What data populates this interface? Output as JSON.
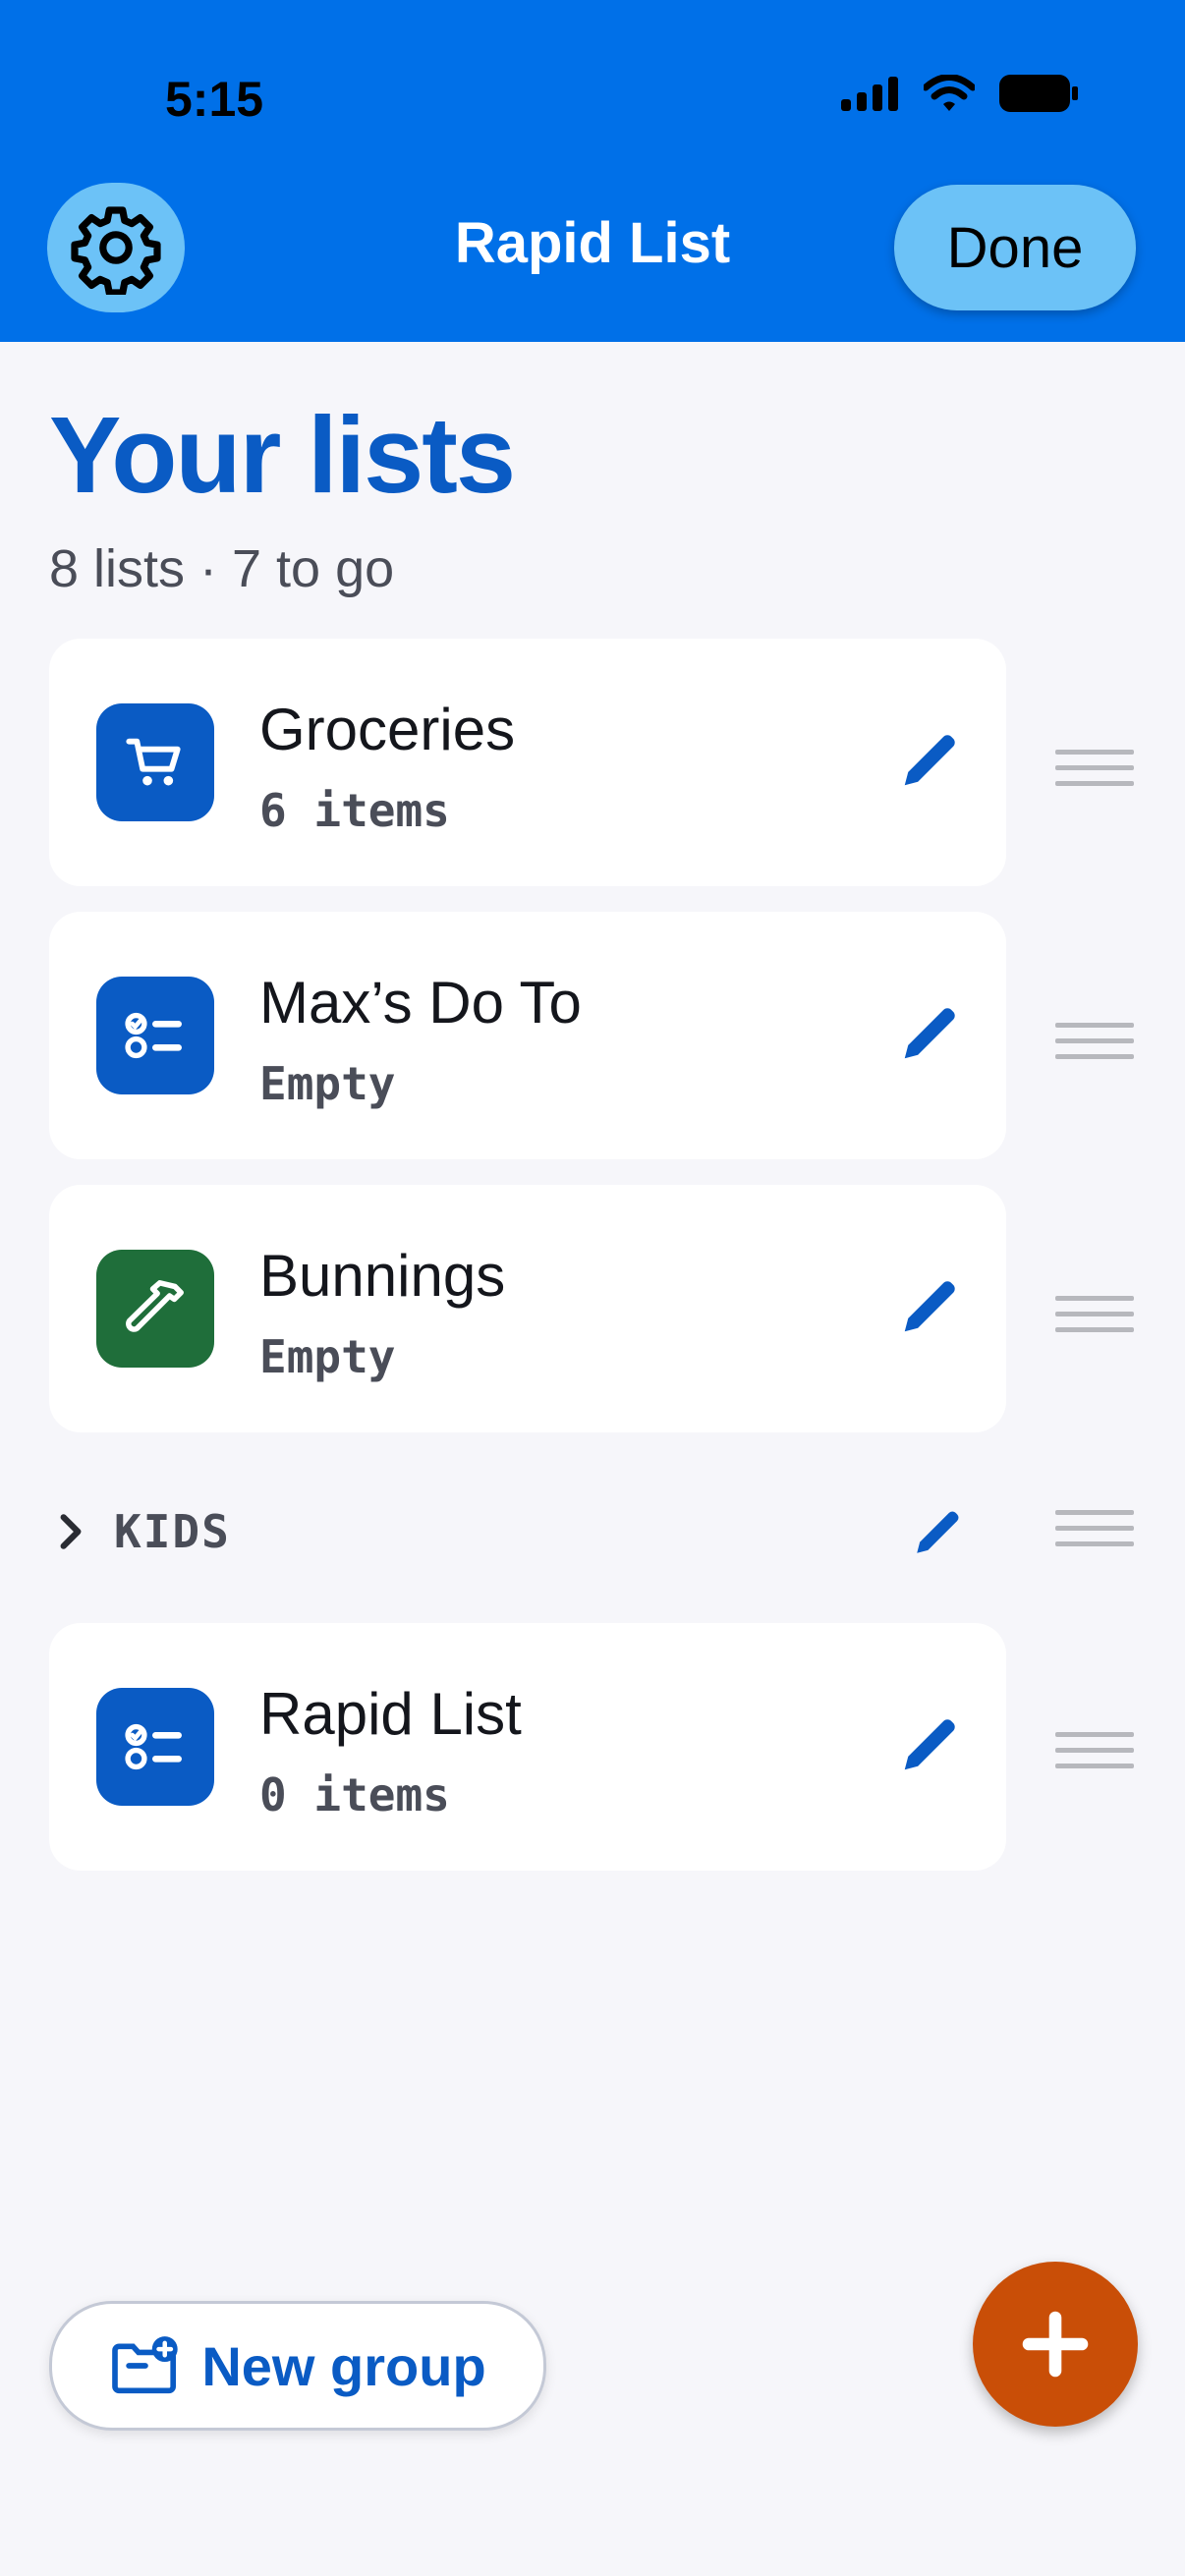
{
  "status_bar": {
    "time": "5:15",
    "icons": [
      "signal-icon",
      "wifi-icon",
      "battery-icon"
    ]
  },
  "header": {
    "title": "Rapid List",
    "settings_icon": "gear-icon",
    "done_label": "Done",
    "background": "#0070e8",
    "button_color": "#6cc2f7"
  },
  "main": {
    "title": "Your lists",
    "subtitle": "8 lists · 7 to go",
    "title_color": "#0a5bc4"
  },
  "lists": [
    {
      "title": "Groceries",
      "subtitle": "6 items",
      "icon": "cart-icon",
      "icon_color": "#0a5bc4"
    },
    {
      "title": "Max’s Do To",
      "subtitle": "Empty",
      "icon": "checklist-icon",
      "icon_color": "#0a5bc4"
    },
    {
      "title": "Bunnings",
      "subtitle": "Empty",
      "icon": "hammer-icon",
      "icon_color": "#1f6e3a"
    }
  ],
  "group": {
    "label": "KIDS",
    "icon": "chevron-right-icon"
  },
  "group_lists": [
    {
      "title": "Rapid List",
      "subtitle": "0 items",
      "icon": "checklist-icon",
      "icon_color": "#0a5bc4"
    }
  ],
  "footer": {
    "new_group_label": "New group",
    "new_group_icon": "folder-plus-icon",
    "fab_icon": "plus-icon",
    "fab_color": "#c94e07"
  }
}
